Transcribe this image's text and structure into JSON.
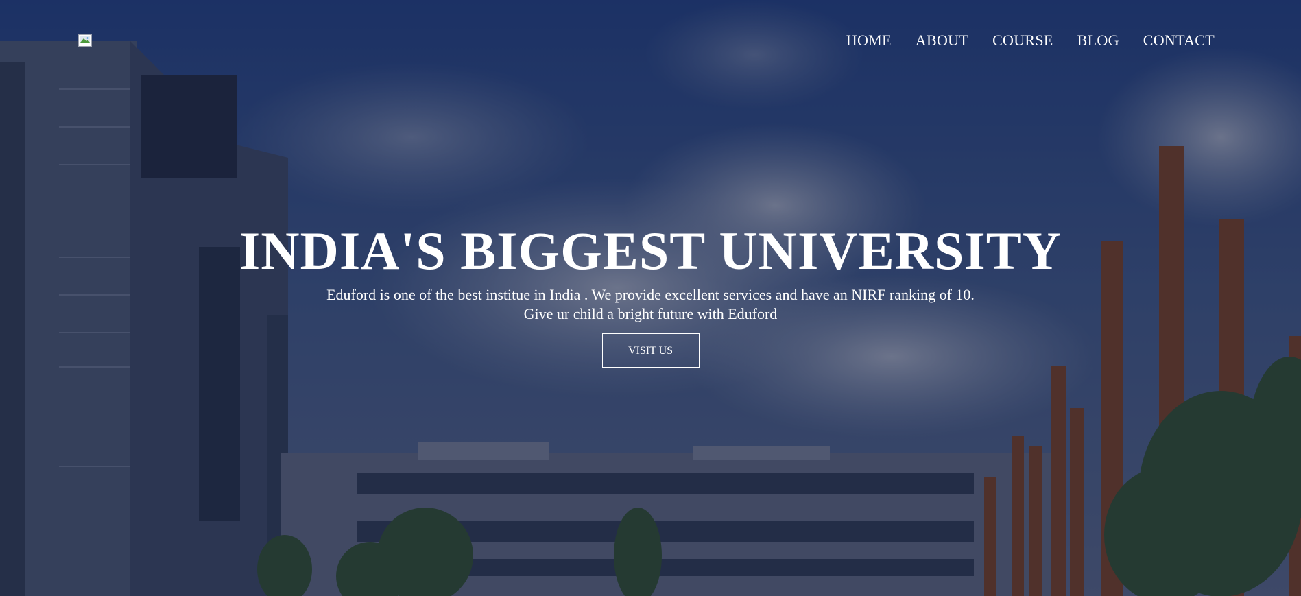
{
  "nav": {
    "logo_alt": "logo",
    "links": [
      {
        "label": "HOME"
      },
      {
        "label": "ABOUT"
      },
      {
        "label": "COURSE"
      },
      {
        "label": "BLOG"
      },
      {
        "label": "CONTACT"
      }
    ]
  },
  "hero": {
    "title": "INDIA'S BIGGEST UNIVERSITY",
    "description_line1": "Eduford is one of the best institue in India . We provide excellent services and have an NIRF ranking of 10.",
    "description_line2": "Give ur child a bright future with Eduford",
    "button_label": "VISIT US"
  },
  "colors": {
    "overlay": "#081437",
    "text": "#ffffff",
    "sky": "#1c2d55",
    "pillars": "#8a4a22"
  }
}
